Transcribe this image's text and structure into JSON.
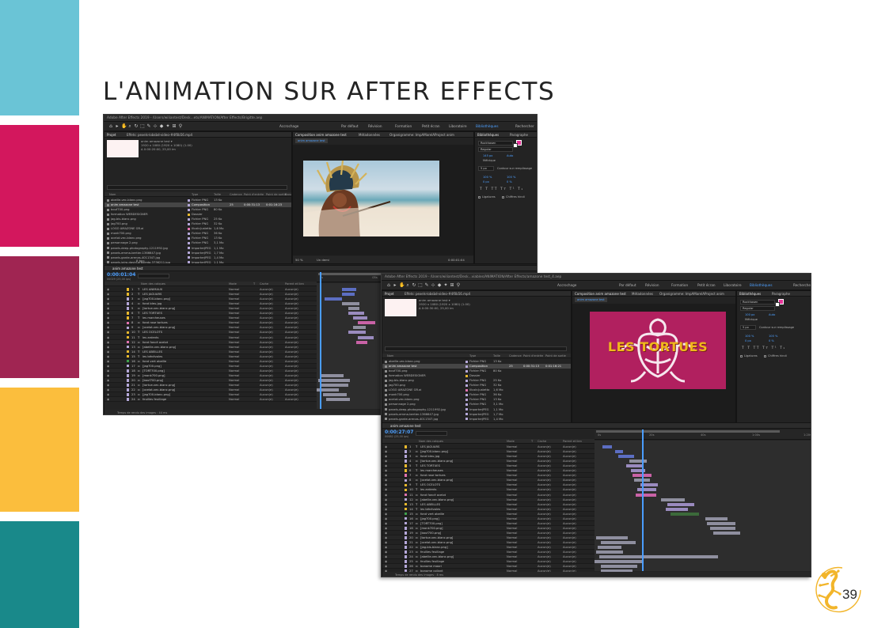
{
  "slide": {
    "title": "L'ANIMATION SUR AFTER EFFECTS",
    "page_number": "39",
    "bands": [
      "#6ac4d6",
      "#d3175d",
      "#a02552",
      "#fbbe3d",
      "#19898a"
    ]
  },
  "colors": {
    "panel": "#232323",
    "accent_blue": "#4a9dff",
    "magenta_comp_bg": "#b1205f",
    "label_yellow": "#e8b92d",
    "label_lavender": "#b5a8d9",
    "label_pink": "#e273b1"
  },
  "ae_back": {
    "window_title": "Adobe After Effects 2019 - /Users/wiliantest/Desk...ets/ANIMATION/After Effects/Brigitte.aep",
    "toolbar": {
      "autokey": "Accrochage",
      "workspaces": [
        "Par défaut",
        "Révision",
        "Formation",
        "Petit écran",
        "Liboratoire",
        "Bibliothèques"
      ],
      "search": "Rechercher"
    },
    "project": {
      "tab": "Projet",
      "effects_tab": "Effets: pexels-lobsbd-video-#4f0b56.mp4",
      "info_lines": [
        "anim amazone test ▾",
        "1920 x 1080 (1920 x 1080) (1.00)",
        "Δ 0:00:20:00, 25,00 im"
      ],
      "columns": [
        "Nom",
        "Type",
        "Taille",
        "Cadence",
        "Point d'entrée",
        "Point de sortie",
        "Band."
      ],
      "rows": [
        {
          "name": "abeille-vec-blanc.png",
          "type": "Fichier PNG",
          "size": "13 Ko",
          "color": "#b5a8d9"
        },
        {
          "name": "anim amazone test",
          "type": "Composition",
          "size": "",
          "fps": "25",
          "in": "0:00:31:13",
          "out": "0:01:16:23",
          "color": "#b5a8d9",
          "selected": true
        },
        {
          "name": "bouf700.png",
          "type": "Fichier PNG",
          "size": "80 Ko",
          "color": "#b5a8d9"
        },
        {
          "name": "formation WEBDESIGNER",
          "type": "Dossier",
          "size": "",
          "color": "#e8b92d"
        },
        {
          "name": "jag-bis-blanc.png",
          "type": "Fichier PNG",
          "size": "25 Ko",
          "color": "#b5a8d9"
        },
        {
          "name": "jag700.png",
          "type": "Fichier PNG",
          "size": "32 Ko",
          "color": "#b5a8d9"
        },
        {
          "name": "LOGO AMAZONE GR.ai",
          "type": "Illustr.Justetto",
          "size": "1,6 Mo",
          "color": "#e273b1"
        },
        {
          "name": "monk700.png",
          "type": "Fichier PNG",
          "size": "36 Ko",
          "color": "#b5a8d9"
        },
        {
          "name": "ocelot-vec-blanc.png",
          "type": "Fichier PNG",
          "size": "13 Ko",
          "color": "#b5a8d9"
        },
        {
          "name": "personnage 2.png",
          "type": "Fichier PNG",
          "size": "3,1 Mo",
          "color": "#b5a8d9"
        },
        {
          "name": "pexels-deep-photography-1211992.jpg",
          "type": "ImporterJPEG",
          "size": "1,1 Mo",
          "color": "#b5a8d9"
        },
        {
          "name": "pexels-emma-bertier-1366647.jpg",
          "type": "ImporterJPEG",
          "size": "1,7 Mo",
          "color": "#b5a8d9"
        },
        {
          "name": "pexels-gante-arenas-4011347.jpg",
          "type": "ImporterJPEG",
          "size": "1,4 Mo",
          "color": "#b5a8d9"
        },
        {
          "name": "pexels-jairo-david-arboleda-3736211.jpg",
          "type": "ImporterJPEG",
          "size": "1,1 Mo",
          "color": "#b5a8d9"
        }
      ],
      "footer": "8 bpc"
    },
    "composition": {
      "tab": "Composition anim amazone test",
      "tab2": "Métadonnées",
      "tab3": "Organigramme: ImpAMarelAProject anim",
      "comp_tab": "anim amazone test",
      "zoom": "50 %",
      "resolution": "Un demi",
      "timecode": "0:00:01:04"
    },
    "character": {
      "tab1": "Bibliothèques",
      "tab2": "Paragraphe",
      "font": "Rockhasen",
      "style": "Regular",
      "size": "145 px",
      "tracking": "Auto",
      "leading_label": "Métrique",
      "stroke_width": "5 px",
      "stroke_label": "Contour sur remplissage",
      "scale_v": "100 %",
      "scale_h": "100 %",
      "baseline": "0 px",
      "tsume": "0 %",
      "ligatures": "Ligatures",
      "hindi": "Chiffres hindi"
    },
    "timeline": {
      "tab": "anim amazone test",
      "timecode": "0:00:01:04",
      "timecode_sub": "00029 (25,00 ips)",
      "columns": [
        "Nom des calques",
        "Mode",
        "T",
        "Cache",
        "Parent et lien"
      ],
      "time_ticks": [
        "0s",
        "05s",
        "10s",
        "15s",
        "20s"
      ],
      "footer": "Temps de rendu des images : 44 ms",
      "layers": [
        {
          "num": "1",
          "name": "LES ANIMAUX",
          "kind": "T",
          "color": "#e8b92d"
        },
        {
          "num": "2",
          "name": "LES JAGUARS",
          "kind": "T",
          "color": "#e8b92d"
        },
        {
          "num": "3",
          "name": "[jag700-blanc.png]",
          "kind": "img",
          "color": "#b5a8d9"
        },
        {
          "num": "4",
          "name": "fond bleu.jpg",
          "kind": "img",
          "color": "#b5a8d9"
        },
        {
          "num": "5",
          "name": "[tortue-vec-blanc.png]",
          "kind": "img",
          "color": "#b5a8d9"
        },
        {
          "num": "6",
          "name": "LES TORTUES",
          "kind": "T",
          "color": "#e8b92d"
        },
        {
          "num": "7",
          "name": "les marcheuses",
          "kind": "T",
          "color": "#e8b92d"
        },
        {
          "num": "8",
          "name": "fond rose tortues",
          "kind": "img",
          "color": "#e273b1"
        },
        {
          "num": "9",
          "name": "[ocelot-vec-blanc.png]",
          "kind": "img",
          "color": "#b5a8d9"
        },
        {
          "num": "10",
          "name": "LES OCELOTS",
          "kind": "T",
          "color": "#e8b92d"
        },
        {
          "num": "11",
          "name": "les ardents",
          "kind": "T",
          "color": "#e8b92d"
        },
        {
          "num": "12",
          "name": "fond foncé ocelot",
          "kind": "img",
          "color": "#e273b1"
        },
        {
          "num": "13",
          "name": "[abeille-vec-blanc.png]",
          "kind": "img",
          "color": "#b5a8d9"
        },
        {
          "num": "14",
          "name": "LES ABEILLES",
          "kind": "T",
          "color": "#e8b92d"
        },
        {
          "num": "15",
          "name": "les bénévoles",
          "kind": "T",
          "color": "#e8b92d"
        },
        {
          "num": "16",
          "name": "fond vert abeille",
          "kind": "img",
          "color": "#3fa34d"
        },
        {
          "num": "17",
          "name": "[jag700.png]",
          "kind": "img",
          "color": "#b5a8d9"
        },
        {
          "num": "18",
          "name": "[TORT700.png]",
          "kind": "img",
          "color": "#b5a8d9"
        },
        {
          "num": "19",
          "name": "[monk700.png]",
          "kind": "img",
          "color": "#b5a8d9"
        },
        {
          "num": "20",
          "name": "[bouf700.png]",
          "kind": "img",
          "color": "#b5a8d9"
        },
        {
          "num": "21",
          "name": "[tortue-vec-blanc.png]",
          "kind": "img",
          "color": "#b5a8d9"
        },
        {
          "num": "22",
          "name": "[ocelot-vec-blanc.png]",
          "kind": "img",
          "color": "#b5a8d9"
        },
        {
          "num": "23",
          "name": "[jag700-blanc.png]",
          "kind": "img",
          "color": "#b5a8d9"
        },
        {
          "num": "24",
          "name": "feuilles feuillage",
          "kind": "img",
          "color": "#b5a8d9"
        }
      ]
    }
  },
  "ae_front": {
    "window_title": "Adobe After Effects 2019 - /Users/wiliantest/Desk...viables/ANIMATION/After Effects/amazone test_4.aep",
    "toolbar": {
      "autokey": "Accrochage",
      "workspaces": [
        "Par défaut",
        "Révision",
        "Formation",
        "Petit écran",
        "Liboratoire",
        "Bibliothèques"
      ],
      "search": "Rechercher"
    },
    "project": {
      "tab": "Projet",
      "effects_tab": "Effets: pexels-lobsbd-video-#4f0b56.mp4",
      "info_lines": [
        "anim amazone test ▾",
        "1920 x 1080 (1920 x 1080) (1.00)",
        "Δ 0:00:30:00, 25,00 im"
      ],
      "columns": [
        "Nom",
        "Type",
        "Taille",
        "Cadence",
        "Point d'entrée",
        "Point de sortie"
      ],
      "rows": [
        {
          "name": "abeille-vec-blanc.png",
          "type": "Fichier PNG",
          "size": "13 Ko",
          "color": "#b5a8d9"
        },
        {
          "name": "anim amazone test",
          "type": "Composition",
          "size": "",
          "fps": "25",
          "in": "0:00:31:13",
          "out": "0:01:16:21",
          "color": "#b5a8d9",
          "selected": true
        },
        {
          "name": "bouf700.png",
          "type": "Fichier PNG",
          "size": "80 Ko",
          "color": "#b5a8d9"
        },
        {
          "name": "formation WEBDESIGNER",
          "type": "Dossier",
          "size": "",
          "color": "#e8b92d"
        },
        {
          "name": "jag-bis-blanc.png",
          "type": "Fichier PNG",
          "size": "25 Ko",
          "color": "#b5a8d9"
        },
        {
          "name": "jag700.png",
          "type": "Fichier PNG",
          "size": "32 Ko",
          "color": "#b5a8d9"
        },
        {
          "name": "LOGO AMAZONE GR.ai",
          "type": "Illustr.Justetto",
          "size": "1,6 Mo",
          "color": "#e273b1"
        },
        {
          "name": "monk700.png",
          "type": "Fichier PNG",
          "size": "36 Ko",
          "color": "#b5a8d9"
        },
        {
          "name": "ocelot-vec-blanc.png",
          "type": "Fichier PNG",
          "size": "13 Ko",
          "color": "#b5a8d9"
        },
        {
          "name": "personnage 2.png",
          "type": "Fichier PNG",
          "size": "3,1 Mo",
          "color": "#b5a8d9"
        },
        {
          "name": "pexels-deep-photography-1211992.jpg",
          "type": "ImporterJPEG",
          "size": "1,1 Mo",
          "color": "#b5a8d9"
        },
        {
          "name": "pexels-emma-bertier-1366647.jpg",
          "type": "ImporterJPEG",
          "size": "1,7 Mo",
          "color": "#b5a8d9"
        },
        {
          "name": "pexels-gante-arenas-4011347.jpg",
          "type": "ImporterJPEG",
          "size": "1,4 Mo",
          "color": "#b5a8d9"
        },
        {
          "name": "pexels-jairo-david-arboleda-3736211.jpg",
          "type": "ImporterJPEG",
          "size": "1,1 Mo",
          "color": "#b5a8d9"
        }
      ],
      "footer": "8 bpc"
    },
    "composition": {
      "tab": "Composition anim amazone test",
      "tab2": "Métadonnées",
      "tab3": "Organigramme: ImpAMarelAProject anim",
      "comp_tab": "anim amazone test",
      "zoom": "50 %",
      "resolution": "Un demi",
      "timecode": "0:00:27:07",
      "comp_text": "LES TORTUES"
    },
    "character": {
      "tab1": "Bibliothèques",
      "tab2": "Paragraphe",
      "font": "Rockhasen",
      "style": "Regular",
      "size": "100 px",
      "tracking": "Auto",
      "leading_label": "Métrique",
      "stroke_width": "5 px",
      "stroke_label": "Contour sur remplissage",
      "scale_v": "100 %",
      "scale_h": "100 %",
      "baseline": "0 px",
      "tsume": "0 %",
      "ligatures": "Ligatures",
      "hindi": "Chiffres hindi"
    },
    "timeline": {
      "tab": "anim amazone test",
      "timecode": "0:00:27:07",
      "timecode_sub": "00682 (25,00 ips)",
      "columns": [
        "Nom des calques",
        "Mode",
        "T",
        "Cache",
        "Parent et lien"
      ],
      "time_ticks": [
        "0s",
        "20s",
        "40s",
        "1:00s",
        "1:20s"
      ],
      "footer": "Temps de rendu des images : 8 ms",
      "layers": [
        {
          "num": "1",
          "name": "LES JAGUARS",
          "kind": "T",
          "color": "#e8b92d"
        },
        {
          "num": "2",
          "name": "[jag700-blanc.png]",
          "kind": "img",
          "color": "#b5a8d9"
        },
        {
          "num": "3",
          "name": "fond bleu.jpg",
          "kind": "img",
          "color": "#b5a8d9"
        },
        {
          "num": "4",
          "name": "[tortue-vec-blanc.png]",
          "kind": "img",
          "color": "#b5a8d9"
        },
        {
          "num": "5",
          "name": "LES TORTUES",
          "kind": "T",
          "color": "#e8b92d"
        },
        {
          "num": "6",
          "name": "les marcheuses",
          "kind": "T",
          "color": "#e8b92d"
        },
        {
          "num": "7",
          "name": "fond rose tortues",
          "kind": "img",
          "color": "#e273b1"
        },
        {
          "num": "8",
          "name": "[ocelot-vec-blanc.png]",
          "kind": "img",
          "color": "#b5a8d9"
        },
        {
          "num": "9",
          "name": "LES OCELOTS",
          "kind": "T",
          "color": "#e8b92d"
        },
        {
          "num": "10",
          "name": "les ardents",
          "kind": "T",
          "color": "#e8b92d"
        },
        {
          "num": "11",
          "name": "fond foncé ocelot",
          "kind": "img",
          "color": "#e273b1"
        },
        {
          "num": "12",
          "name": "[abeille-vec-blanc.png]",
          "kind": "img",
          "color": "#b5a8d9"
        },
        {
          "num": "13",
          "name": "LES ABEILLES",
          "kind": "T",
          "color": "#e8b92d"
        },
        {
          "num": "14",
          "name": "les bénévoles",
          "kind": "T",
          "color": "#e8b92d"
        },
        {
          "num": "15",
          "name": "fond vert abeille",
          "kind": "img",
          "color": "#3fa34d"
        },
        {
          "num": "16",
          "name": "[jag700.png]",
          "kind": "img",
          "color": "#b5a8d9"
        },
        {
          "num": "17",
          "name": "[TORT700.png]",
          "kind": "img",
          "color": "#b5a8d9"
        },
        {
          "num": "18",
          "name": "[monk700.png]",
          "kind": "img",
          "color": "#b5a8d9"
        },
        {
          "num": "19",
          "name": "[bouf700.png]",
          "kind": "img",
          "color": "#b5a8d9"
        },
        {
          "num": "20",
          "name": "[tortue-vec-blanc.png]",
          "kind": "img",
          "color": "#b5a8d9"
        },
        {
          "num": "21",
          "name": "[ocelot-vec-blanc.png]",
          "kind": "img",
          "color": "#b5a8d9"
        },
        {
          "num": "22",
          "name": "[jag-bis-blanc.png]",
          "kind": "img",
          "color": "#b5a8d9"
        },
        {
          "num": "23",
          "name": "feuilles feuillage",
          "kind": "img",
          "color": "#b5a8d9"
        },
        {
          "num": "24",
          "name": "[abeille-vec-blanc.png]",
          "kind": "img",
          "color": "#b5a8d9"
        },
        {
          "num": "25",
          "name": "feuilles feuillage",
          "kind": "img",
          "color": "#b5a8d9"
        },
        {
          "num": "26",
          "name": "bonome maori",
          "kind": "img",
          "color": "#b5a8d9"
        },
        {
          "num": "27",
          "name": "bonome collant",
          "kind": "img",
          "color": "#b5a8d9"
        }
      ]
    }
  }
}
